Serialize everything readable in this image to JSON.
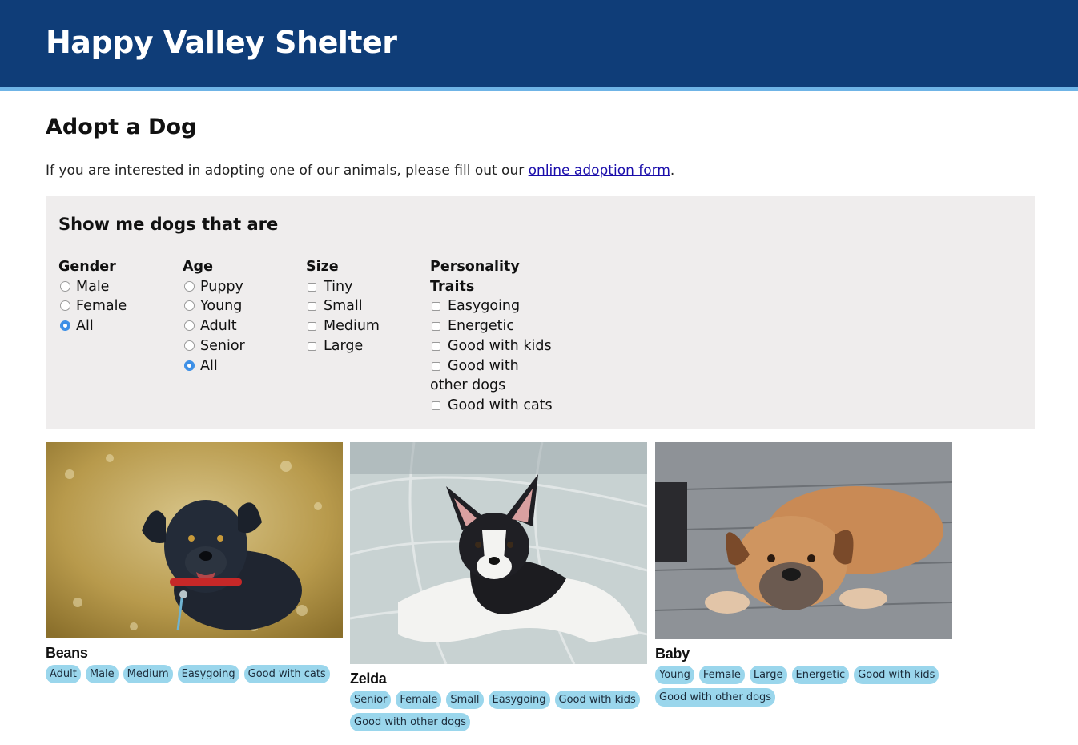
{
  "header": {
    "title": "Happy Valley Shelter",
    "bg": "#0f3d78",
    "accent": "#6fb4e6"
  },
  "page": {
    "heading": "Adopt a Dog",
    "intro_before": "If you are interested in adopting one of our animals, please fill out our ",
    "intro_link": "online adoption form",
    "intro_after": "."
  },
  "filters": {
    "heading": "Show me dogs that are",
    "gender": {
      "title": "Gender",
      "options": [
        "Male",
        "Female",
        "All"
      ],
      "selected": "All"
    },
    "age": {
      "title": "Age",
      "options": [
        "Puppy",
        "Young",
        "Adult",
        "Senior",
        "All"
      ],
      "selected": "All"
    },
    "size": {
      "title": "Size",
      "options": [
        "Tiny",
        "Small",
        "Medium",
        "Large"
      ]
    },
    "personality": {
      "title_line1": "Personality",
      "title_line2": "Traits",
      "options": [
        "Easygoing",
        "Energetic",
        "Good with kids",
        "Good with",
        "other dogs",
        "Good with cats"
      ]
    }
  },
  "dogs": [
    {
      "name": "Beans",
      "tags": [
        "Adult",
        "Male",
        "Medium",
        "Easygoing",
        "Good with cats"
      ]
    },
    {
      "name": "Zelda",
      "tags": [
        "Senior",
        "Female",
        "Small",
        "Easygoing",
        "Good with kids",
        "Good with other dogs"
      ]
    },
    {
      "name": "Baby",
      "tags": [
        "Young",
        "Female",
        "Large",
        "Energetic",
        "Good with kids",
        "Good with other dogs"
      ]
    }
  ],
  "colors": {
    "panel_bg": "#efeded",
    "tag_bg": "#9ad6ec",
    "link": "#1a0dab",
    "radio_selected": "#3a8ee6"
  }
}
